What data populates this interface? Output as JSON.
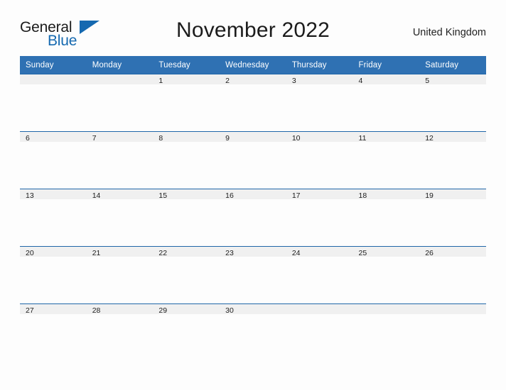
{
  "brand": {
    "word1": "General",
    "word2": "Blue",
    "flag_icon": "triangle-flag-icon",
    "colors": {
      "text": "#1b1b1b",
      "accent": "#1569b0"
    }
  },
  "header": {
    "title": "November 2022",
    "region": "United Kingdom"
  },
  "theme": {
    "header_bg": "#2f71b3",
    "header_text": "#ffffff",
    "rule": "#1f66a8",
    "band_bg": "#f0f0f0",
    "page_bg": "#fdfdfd"
  },
  "calendar": {
    "month": "November",
    "year": "2022",
    "weekday_headers": [
      "Sunday",
      "Monday",
      "Tuesday",
      "Wednesday",
      "Thursday",
      "Friday",
      "Saturday"
    ],
    "weeks": [
      [
        "",
        "",
        "1",
        "2",
        "3",
        "4",
        "5"
      ],
      [
        "6",
        "7",
        "8",
        "9",
        "10",
        "11",
        "12"
      ],
      [
        "13",
        "14",
        "15",
        "16",
        "17",
        "18",
        "19"
      ],
      [
        "20",
        "21",
        "22",
        "23",
        "24",
        "25",
        "26"
      ],
      [
        "27",
        "28",
        "29",
        "30",
        "",
        "",
        ""
      ]
    ]
  }
}
